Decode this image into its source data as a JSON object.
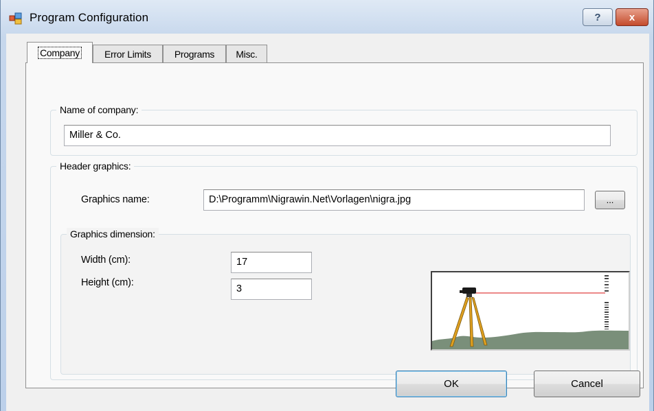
{
  "window": {
    "title": "Program Configuration",
    "help_symbol": "?",
    "close_symbol": "x"
  },
  "tabs": [
    {
      "label": "Company",
      "active": true
    },
    {
      "label": "Error Limits",
      "active": false
    },
    {
      "label": "Programs",
      "active": false
    },
    {
      "label": "Misc.",
      "active": false
    }
  ],
  "company": {
    "name_group_title": "Name of company:",
    "name_value": "Miller & Co.",
    "header_group_title": "Header graphics:",
    "graphics_name_label": "Graphics name:",
    "graphics_name_value": "D:\\Programm\\Nigrawin.Net\\Vorlagen\\nigra.jpg",
    "browse_label": "...",
    "dimension_group_title": "Graphics dimension:",
    "width_label": "Width (cm):",
    "width_value": "17",
    "height_label": "Height (cm):",
    "height_value": "3",
    "preview_icon": "surveying-level-tripod-graphic"
  },
  "footer": {
    "ok_label": "OK",
    "cancel_label": "Cancel"
  },
  "colors": {
    "title_gradient_top": "#dfe9f5",
    "close_button": "#c44b2c",
    "tab_page_bg": "#f9f9f9",
    "preview_ground": "#7a8f7a",
    "preview_tripod": "#e0a020",
    "preview_line": "#e04040"
  }
}
